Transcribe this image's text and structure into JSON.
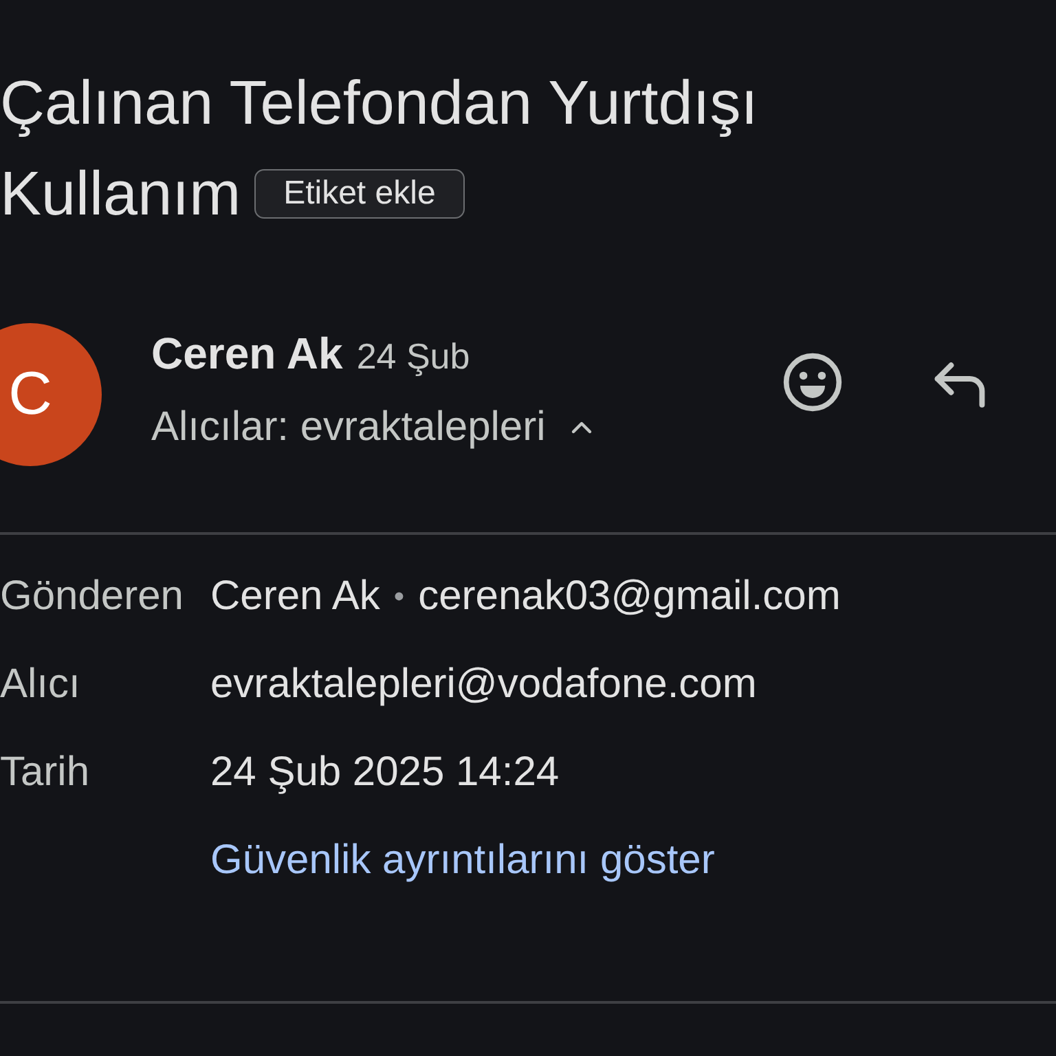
{
  "subject": {
    "title_lines": [
      "Çalınan Telefondan Yurtdışı",
      "Kullanım"
    ],
    "label_chip": "Etiket ekle"
  },
  "message": {
    "avatar_letter": "C",
    "sender": "Ceren Ak",
    "date": "24 Şub",
    "recipients": "Alıcılar: evraktalepleri",
    "expanded": true
  },
  "details": {
    "rows": [
      {
        "label": "Gönderen",
        "name": "Ceren Ak",
        "separator": "•",
        "value": "cerenak03@gmail.com"
      },
      {
        "label": "Alıcı",
        "value": "evraktalepleri@vodafone.com"
      },
      {
        "label": "Tarih",
        "value": "24 Şub 2025 14:24"
      }
    ],
    "security_link": "Güvenlik ayrıntılarını göster"
  }
}
